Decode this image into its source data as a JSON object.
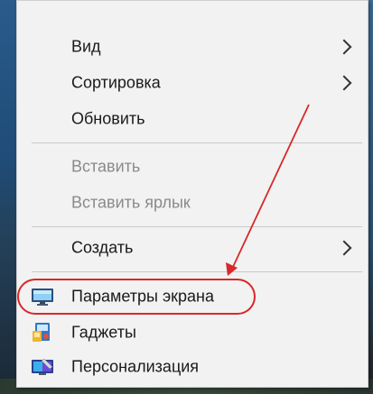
{
  "menu": {
    "items": [
      {
        "label": "Вид",
        "submenu": true,
        "disabled": false
      },
      {
        "label": "Сортировка",
        "submenu": true,
        "disabled": false
      },
      {
        "label": "Обновить",
        "submenu": false,
        "disabled": false
      },
      {
        "label": "Вставить",
        "submenu": false,
        "disabled": true
      },
      {
        "label": "Вставить ярлык",
        "submenu": false,
        "disabled": true
      },
      {
        "label": "Создать",
        "submenu": true,
        "disabled": false
      },
      {
        "label": "Параметры экрана",
        "icon": "display-icon",
        "submenu": false,
        "disabled": false
      },
      {
        "label": "Гаджеты",
        "icon": "gadgets-icon",
        "submenu": false,
        "disabled": false
      },
      {
        "label": "Персонализация",
        "icon": "personalization-icon",
        "submenu": false,
        "disabled": false
      }
    ]
  },
  "annotation": {
    "color": "#d8282a"
  }
}
